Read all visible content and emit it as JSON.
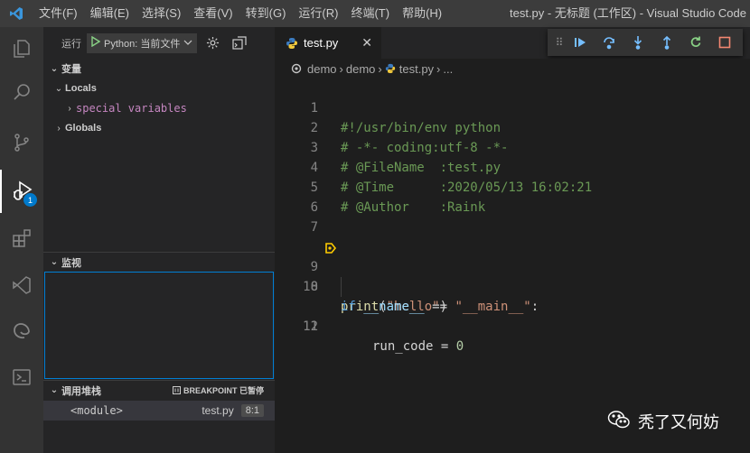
{
  "titlebar": {
    "menu": [
      "文件(F)",
      "编辑(E)",
      "选择(S)",
      "查看(V)",
      "转到(G)",
      "运行(R)",
      "终端(T)",
      "帮助(H)"
    ],
    "window_title": "test.py - 无标题 (工作区) - Visual Studio Code"
  },
  "activity": {
    "debug_badge": "1"
  },
  "sidebar": {
    "run_label": "运行",
    "config_select": "Python: 当前文件",
    "variables_header": "变量",
    "locals_label": "Locals",
    "special_variables": "special variables",
    "globals_label": "Globals",
    "watch_header": "监视",
    "callstack_header": "调用堆栈",
    "breakpoint_status": "BREAKPOINT 已暂停",
    "stack_frame": {
      "name": "<module>",
      "file": "test.py",
      "position": "8:1"
    }
  },
  "editor": {
    "tab_name": "test.py",
    "breadcrumb": [
      "demo",
      "demo",
      "test.py",
      "..."
    ],
    "lines": [
      {
        "num": "1",
        "text": "#!/usr/bin/env python"
      },
      {
        "num": "2",
        "text": "# -*- coding:utf-8 -*-"
      },
      {
        "num": "3",
        "text": "# @FileName  :test.py"
      },
      {
        "num": "4",
        "text": "# @Time      :2020/05/13 16:02:21"
      },
      {
        "num": "5",
        "text": "# @Author    :Raink"
      },
      {
        "num": "6",
        "text": ""
      },
      {
        "num": "7",
        "text": ""
      },
      {
        "num": "8",
        "fn": "print",
        "paren_open": "(",
        "str": "\"hello\"",
        "paren_close": ")"
      },
      {
        "num": "9",
        "text": ""
      },
      {
        "num": "10",
        "kw": "if",
        "var": "__name__",
        "op": " == ",
        "str": "\"__main__\"",
        "colon": ":"
      },
      {
        "num": "11",
        "var": "run_code",
        "op": " = ",
        "numval": "0"
      },
      {
        "num": "12",
        "text": ""
      }
    ],
    "current_line": 8
  },
  "watermark": {
    "text": "秃了又何妨"
  },
  "colors": {
    "accent": "#007acc",
    "highlight_line": "#4b4b18",
    "comment": "#6a9955",
    "string": "#ce9178",
    "keyword": "#569cd6"
  },
  "icons": [
    "vscode-logo-icon",
    "explorer-icon",
    "search-icon",
    "source-control-icon",
    "run-debug-icon",
    "extensions-icon",
    "remote-icon",
    "edge-icon",
    "terminal-icon",
    "play-icon",
    "gear-icon",
    "open-terminal-icon",
    "python-icon",
    "continue-icon",
    "step-over-icon",
    "step-into-icon",
    "step-out-icon",
    "restart-icon",
    "stop-icon",
    "wechat-icon"
  ]
}
